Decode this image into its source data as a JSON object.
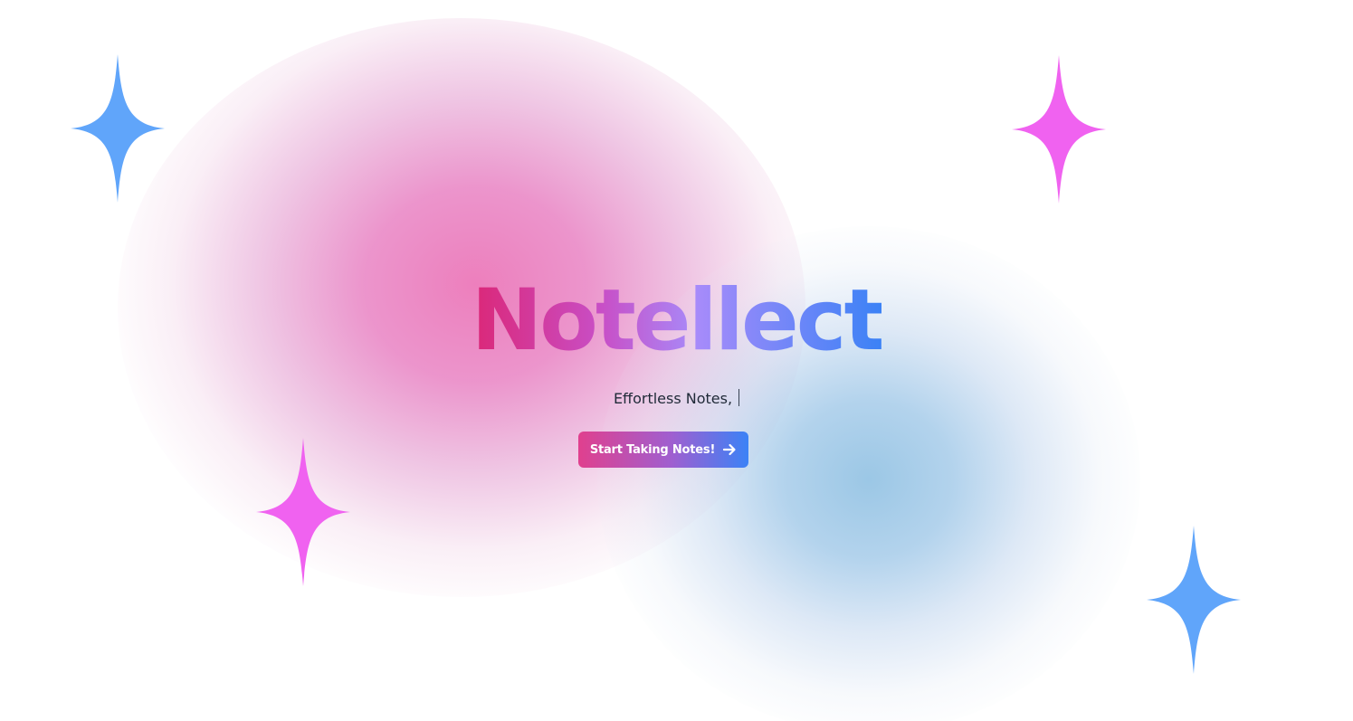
{
  "hero": {
    "title": "Notellect",
    "subtitle": "Effortless Notes,",
    "cta_label": "Start Taking Notes!",
    "cta_icon": "arrow-right-icon"
  },
  "colors": {
    "title_gradient": [
      "#db2777",
      "#c84fc7",
      "#a78bfa",
      "#3b82f6"
    ],
    "button_gradient": [
      "#e0408e",
      "#9f5fd0",
      "#3b82f6"
    ],
    "sparkle_blue": "#60a5fa",
    "sparkle_pink": "#f062f0",
    "blob_pink": "#ec78b9",
    "blob_blue": "#96c4e4"
  },
  "decorations": {
    "sparkles": [
      {
        "name": "sparkle-top-left",
        "color": "blue"
      },
      {
        "name": "sparkle-top-right",
        "color": "pink"
      },
      {
        "name": "sparkle-mid-left",
        "color": "pink"
      },
      {
        "name": "sparkle-bottom-right",
        "color": "blue"
      }
    ]
  }
}
